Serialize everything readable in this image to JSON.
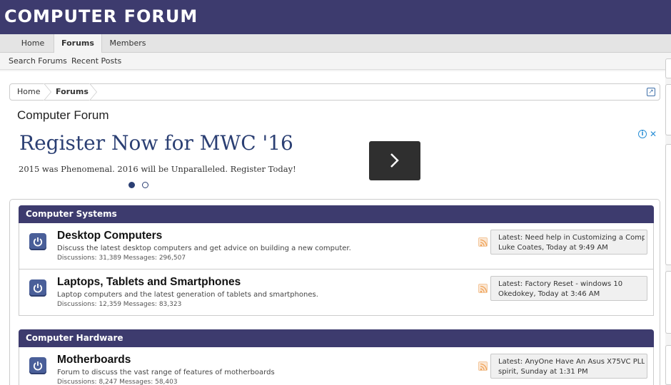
{
  "header": {
    "logo": "COMPUTER FORUM"
  },
  "nav": {
    "tabs": [
      {
        "label": "Home"
      },
      {
        "label": "Forums"
      },
      {
        "label": "Members"
      }
    ]
  },
  "subnav": {
    "items": [
      {
        "label": "Search Forums"
      },
      {
        "label": "Recent Posts"
      }
    ]
  },
  "breadcrumb": {
    "items": [
      {
        "label": "Home"
      },
      {
        "label": "Forums"
      }
    ],
    "jump_icon": "external-jump-icon"
  },
  "page": {
    "title": "Computer Forum"
  },
  "ad": {
    "headline": "Register Now for MWC '16",
    "subtext": "2015 was Phenomenal. 2016 will be Unparalleled. Register Today!",
    "info": "i",
    "close": "✕",
    "accent": "#2b3f73"
  },
  "categories": [
    {
      "title": "Computer Systems",
      "nodes": [
        {
          "title": "Desktop Computers",
          "description": "Discuss the latest desktop computers and get advice on building a new computer.",
          "stats": "Discussions: 31,389 Messages: 296,507",
          "latest_title": "Latest: Need help in Customizing a Comp...",
          "latest_meta": "Luke Coates, Today at 9:49 AM"
        },
        {
          "title": "Laptops, Tablets and Smartphones",
          "description": "Laptop computers and the latest generation of tablets and smartphones.",
          "stats": "Discussions: 12,359 Messages: 83,323",
          "latest_title": "Latest: Factory Reset - windows 10",
          "latest_meta": "Okedokey, Today at 3:46 AM"
        }
      ]
    },
    {
      "title": "Computer Hardware",
      "nodes": [
        {
          "title": "Motherboards",
          "description": "Forum to discuss the vast range of features of motherboards",
          "stats": "Discussions: 8,247 Messages: 58,403",
          "latest_title": "Latest: AnyOne Have An Asus X75VC PLL ?",
          "latest_meta": "spirit, Sunday at 1:31 PM"
        }
      ]
    }
  ],
  "colors": {
    "header_bg": "#3d3b6e",
    "category_bg": "#3d3b6e",
    "node_icon_bg": "#4a5f99"
  }
}
